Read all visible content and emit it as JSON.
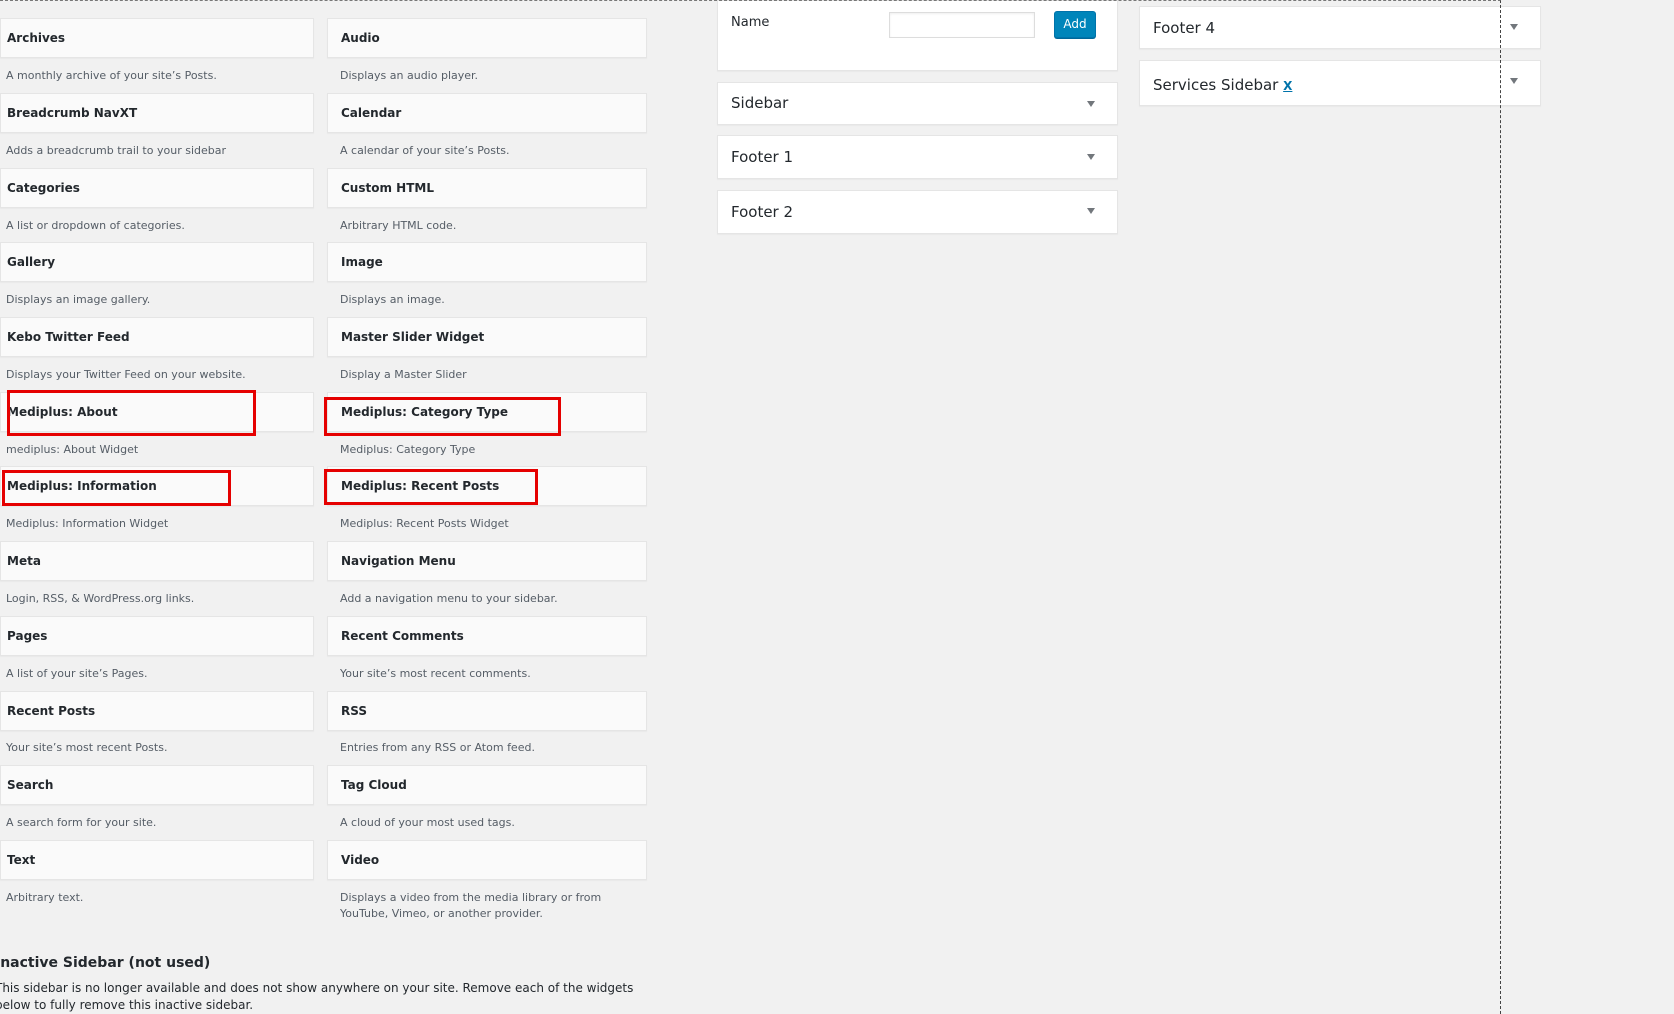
{
  "available_widgets": {
    "left": [
      {
        "title": "Archives",
        "description": "A monthly archive of your site’s Posts."
      },
      {
        "title": "Breadcrumb NavXT",
        "description": "Adds a breadcrumb trail to your sidebar"
      },
      {
        "title": "Categories",
        "description": "A list or dropdown of categories."
      },
      {
        "title": "Gallery",
        "description": "Displays an image gallery."
      },
      {
        "title": "Kebo Twitter Feed",
        "description": "Displays your Twitter Feed on your website."
      },
      {
        "title": "Mediplus: About",
        "description": "mediplus: About Widget"
      },
      {
        "title": "Mediplus: Information",
        "description": "Mediplus: Information Widget"
      },
      {
        "title": "Meta",
        "description": "Login, RSS, & WordPress.org links."
      },
      {
        "title": "Pages",
        "description": "A list of your site’s Pages."
      },
      {
        "title": "Recent Posts",
        "description": "Your site’s most recent Posts."
      },
      {
        "title": "Search",
        "description": "A search form for your site."
      },
      {
        "title": "Text",
        "description": "Arbitrary text."
      }
    ],
    "right": [
      {
        "title": "Audio",
        "description": "Displays an audio player."
      },
      {
        "title": "Calendar",
        "description": "A calendar of your site’s Posts."
      },
      {
        "title": "Custom HTML",
        "description": "Arbitrary HTML code."
      },
      {
        "title": "Image",
        "description": "Displays an image."
      },
      {
        "title": "Master Slider Widget",
        "description": "Display a Master Slider"
      },
      {
        "title": "Mediplus: Category Type",
        "description": "Mediplus: Category Type"
      },
      {
        "title": "Mediplus: Recent Posts",
        "description": "Mediplus: Recent Posts Widget"
      },
      {
        "title": "Navigation Menu",
        "description": "Add a navigation menu to your sidebar."
      },
      {
        "title": "Recent Comments",
        "description": "Your site’s most recent comments."
      },
      {
        "title": "RSS",
        "description": "Entries from any RSS or Atom feed."
      },
      {
        "title": "Tag Cloud",
        "description": "A cloud of your most used tags."
      },
      {
        "title": "Video",
        "description": "Displays a video from the media library or from YouTube, Vimeo, or another provider."
      }
    ]
  },
  "new_sidebar_form": {
    "name_label": "Name",
    "add_label": "Add"
  },
  "sidebars_middle": [
    "Sidebar",
    "Footer 1",
    "Footer 2"
  ],
  "sidebars_right": {
    "footer4": "Footer 4",
    "services": "Services Sidebar",
    "services_remove": "X"
  },
  "inactive_sidebar": {
    "heading": "Inactive Sidebar (not used)",
    "description": "This sidebar is no longer available and does not show anywhere on your site. Remove each of the widgets below to fully remove this inactive sidebar."
  },
  "colors": {
    "highlight": "#e50000",
    "primary_button": "#0085ba",
    "link": "#0073aa"
  }
}
